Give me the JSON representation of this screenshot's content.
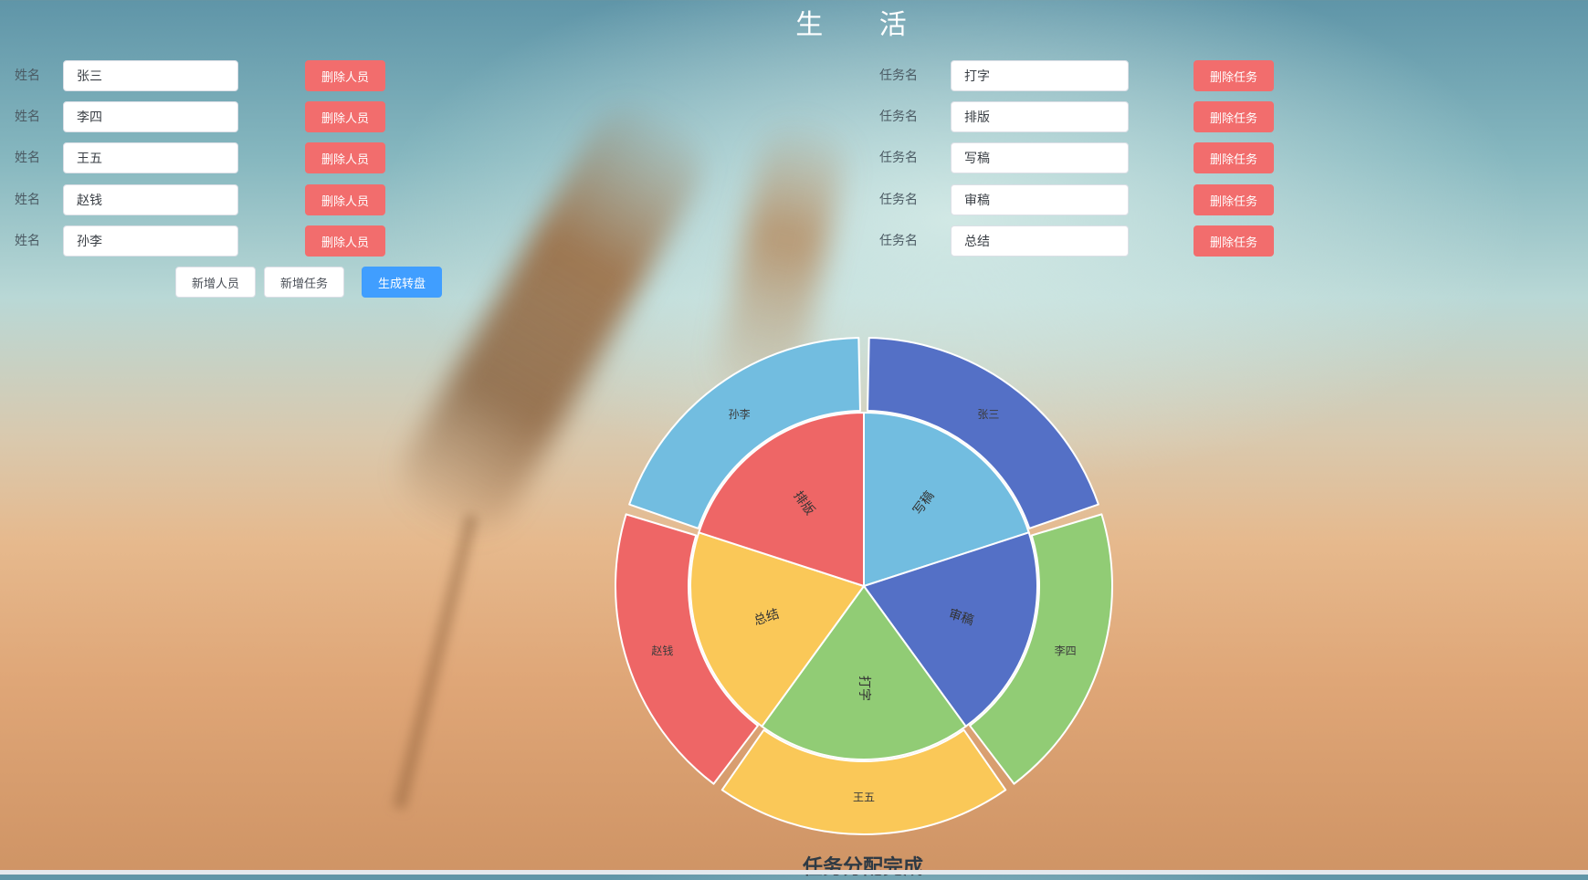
{
  "header": {
    "title": "生 活"
  },
  "people": {
    "field_label": "姓名",
    "delete_label": "删除人员",
    "names": [
      "张三",
      "李四",
      "王五",
      "赵钱",
      "孙李"
    ]
  },
  "tasks": {
    "field_label": "任务名",
    "delete_label": "删除任务",
    "names": [
      "打字",
      "排版",
      "写稿",
      "审稿",
      "总结"
    ]
  },
  "actions": {
    "add_person": "新增人员",
    "add_task": "新增任务",
    "generate_wheel": "生成转盘"
  },
  "colors": {
    "danger": "#f26d6d",
    "primary": "#409eff",
    "wheel_light_blue": "#72bde0",
    "wheel_dark_blue": "#5470c6",
    "wheel_green": "#91cc75",
    "wheel_yellow": "#fac858",
    "wheel_red": "#ee6666"
  },
  "wheel": {
    "inner": [
      {
        "task": "写稿",
        "color": "#72bde0"
      },
      {
        "task": "审稿",
        "color": "#5470c6"
      },
      {
        "task": "打字",
        "color": "#91cc75"
      },
      {
        "task": "总结",
        "color": "#fac858"
      },
      {
        "task": "排版",
        "color": "#ee6666"
      }
    ],
    "outer": [
      {
        "person": "张三",
        "color": "#5470c6"
      },
      {
        "person": "李四",
        "color": "#91cc75"
      },
      {
        "person": "王五",
        "color": "#fac858"
      },
      {
        "person": "赵钱",
        "color": "#ee6666"
      },
      {
        "person": "孙李",
        "color": "#72bde0"
      }
    ]
  },
  "status": {
    "text": "任务分配完成"
  }
}
